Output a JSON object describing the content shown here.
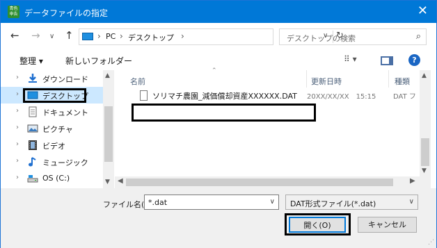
{
  "window": {
    "title": "データファイルの指定",
    "app_icon_text": "青色\n申告",
    "close_glyph": "✕"
  },
  "navbar": {
    "back": "←",
    "forward": "→",
    "dropdown": "∨",
    "up": "↑",
    "breadcrumb": [
      "PC",
      "デスクトップ"
    ],
    "crumb_sep": "›",
    "search_placeholder": "デスクトップの検索"
  },
  "toolbar": {
    "organize": "整理 ▾",
    "new_folder": "新しいフォルダー",
    "view_glyph": "⠿ ▾"
  },
  "nav_pane": {
    "items": [
      {
        "label": "ダウンロード",
        "icon": "download-icon",
        "selected": false
      },
      {
        "label": "デスクトップ",
        "icon": "desktop-icon",
        "selected": true
      },
      {
        "label": "ドキュメント",
        "icon": "document-icon",
        "selected": false
      },
      {
        "label": "ピクチャ",
        "icon": "picture-icon",
        "selected": false
      },
      {
        "label": "ビデオ",
        "icon": "video-icon",
        "selected": false
      },
      {
        "label": "ミュージック",
        "icon": "music-icon",
        "selected": false
      },
      {
        "label": "OS (C:)",
        "icon": "drive-icon",
        "selected": false
      }
    ]
  },
  "file_list": {
    "columns": [
      "名前",
      "更新日時",
      "種類"
    ],
    "rows": [
      {
        "name": "ソリマチ農園_減価償却資産XXXXXX.DAT",
        "modified": "20XX/XX/XX　15:15",
        "type": "DAT フ"
      }
    ]
  },
  "footer": {
    "filename_label": "ファイル名(N):",
    "filename_value": "*.dat",
    "filetype_value": "DAT形式ファイル(*.dat)",
    "open_button": "開く(O)",
    "cancel_button": "キャンセル"
  },
  "colors": {
    "titlebar": "#0078d7",
    "selection": "#cce8ff",
    "highlight_border": "#000000"
  }
}
